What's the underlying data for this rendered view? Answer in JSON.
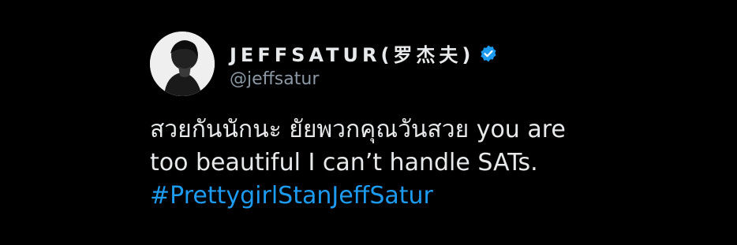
{
  "tweet": {
    "display_name": "JEFFSATUR(罗杰夫)",
    "handle": "@jeffsatur",
    "verified_icon": "verified-badge-icon",
    "text_line_1": "สวยกันนักนะ ยัยพวกคุณวันสวย you are",
    "text_line_2": "too beautiful I can’t handle SATs.",
    "hashtag": "#PrettygirlStanJeffSatur"
  },
  "colors": {
    "background": "#000000",
    "text": "#e7e9ea",
    "secondary": "#8b98a5",
    "accent": "#1d9bf0"
  }
}
